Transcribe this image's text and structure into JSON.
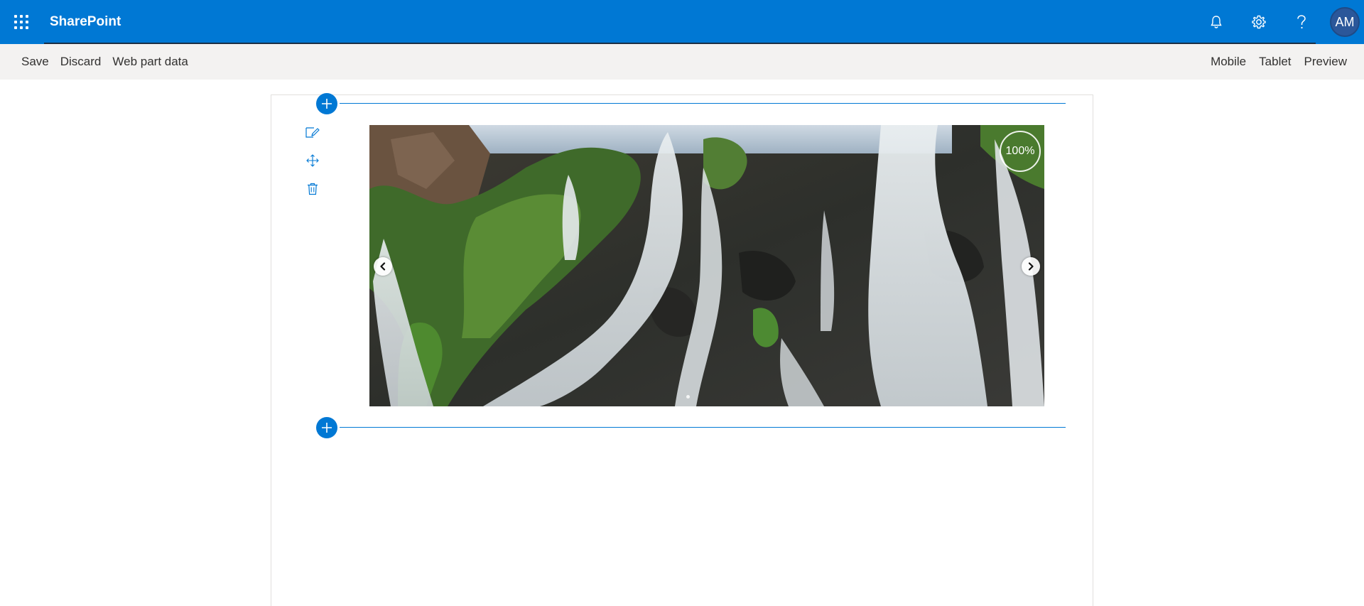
{
  "suitebar": {
    "app_name": "SharePoint",
    "avatar_initials": "AM",
    "bg_color": "#0078d4",
    "icons": [
      "waffle-icon",
      "bell-icon",
      "gear-icon",
      "help-icon"
    ]
  },
  "commands": {
    "left": [
      "Save",
      "Discard",
      "Web part data"
    ],
    "right": [
      "Mobile",
      "Tablet",
      "Preview"
    ]
  },
  "webpart": {
    "toolbar_icons": [
      "edit-icon",
      "move-icon",
      "delete-icon"
    ],
    "zoom_label": "100%",
    "carousel_icons": [
      "chevron-left-icon",
      "chevron-right-icon"
    ]
  }
}
